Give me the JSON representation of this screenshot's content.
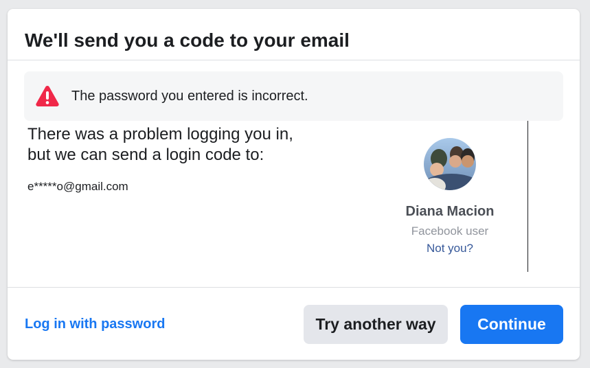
{
  "dialog": {
    "title": "We'll send you a code to your email"
  },
  "alert": {
    "icon": "warning-triangle-icon",
    "icon_color": "#f02849",
    "message": "The password you entered is incorrect."
  },
  "recovery": {
    "line1": "There was a problem logging you in,",
    "line2": "but we can send a login code to:",
    "masked_email": "e*****o@gmail.com"
  },
  "profile": {
    "name": "Diana Macion",
    "role": "Facebook user",
    "not_you_label": "Not you?"
  },
  "footer": {
    "login_password_label": "Log in with password",
    "try_another_label": "Try another way",
    "continue_label": "Continue"
  },
  "colors": {
    "brand": "#1877f2",
    "alert_bg": "#f5f6f7",
    "secondary_button_bg": "#e4e6eb"
  }
}
